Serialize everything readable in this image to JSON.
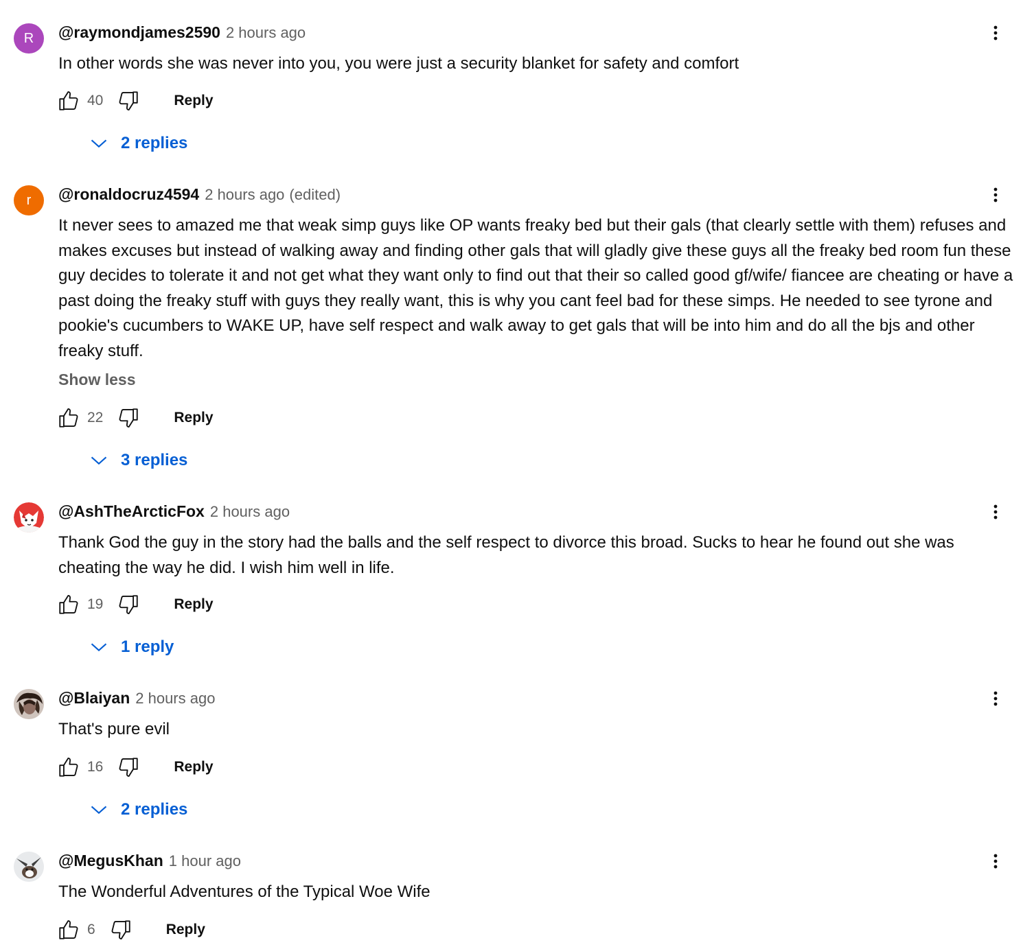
{
  "comments": [
    {
      "avatar_letter": "R",
      "avatar_color": "#ab47bc",
      "author": "@raymondjames2590",
      "time": "2 hours ago",
      "edited": "",
      "text": "In other words she was never into you, you were just a security blanket for safety and comfort",
      "likes": "40",
      "reply_label": "Reply",
      "replies_label": "2 replies"
    },
    {
      "avatar_letter": "r",
      "avatar_color": "#ef6c00",
      "author": "@ronaldocruz4594",
      "time": "2 hours ago",
      "edited": "(edited)",
      "text": "It never sees to amazed me that weak simp guys like OP wants freaky bed but their gals (that clearly settle with them) refuses and makes excuses but instead of walking away and finding other gals that will gladly give these guys all the freaky bed room fun these guy decides to tolerate it and not get what they want only to find out that their so called good gf/wife/ fiancee are cheating or have a past doing the freaky stuff with guys they really want, this is why you cant feel bad for these simps. He needed to see tyrone and pookie's cucumbers to WAKE UP, have self respect and walk away to get gals that will be into him and do all the bjs and other freaky stuff.",
      "show_less": "Show less",
      "likes": "22",
      "reply_label": "Reply",
      "replies_label": "3 replies"
    },
    {
      "avatar_icon": "fox-avatar-icon",
      "author": "@AshTheArcticFox",
      "time": "2 hours ago",
      "edited": "",
      "text": "Thank God the guy in the story had the balls and the self respect to divorce this broad. Sucks to hear he found out she was cheating the way he did. I wish him well in life.",
      "likes": "19",
      "reply_label": "Reply",
      "replies_label": "1 reply"
    },
    {
      "avatar_icon": "photo-avatar-icon",
      "author": "@Blaiyan",
      "time": "2 hours ago",
      "edited": "",
      "text": "That's pure evil",
      "likes": "16",
      "reply_label": "Reply",
      "replies_label": "2 replies"
    },
    {
      "avatar_icon": "animal-avatar-icon",
      "author": "@MegusKhan",
      "time": "1 hour ago",
      "edited": "",
      "text": "The Wonderful Adventures of the Typical Woe Wife",
      "likes": "6",
      "reply_label": "Reply"
    }
  ],
  "icons": {
    "like": "thumbs-up-icon",
    "dislike": "thumbs-down-icon",
    "menu": "more-vert-icon",
    "expand": "chevron-down-icon"
  },
  "colors": {
    "link_blue": "#065fd4",
    "secondary_text": "#606060",
    "primary_text": "#0f0f0f"
  }
}
